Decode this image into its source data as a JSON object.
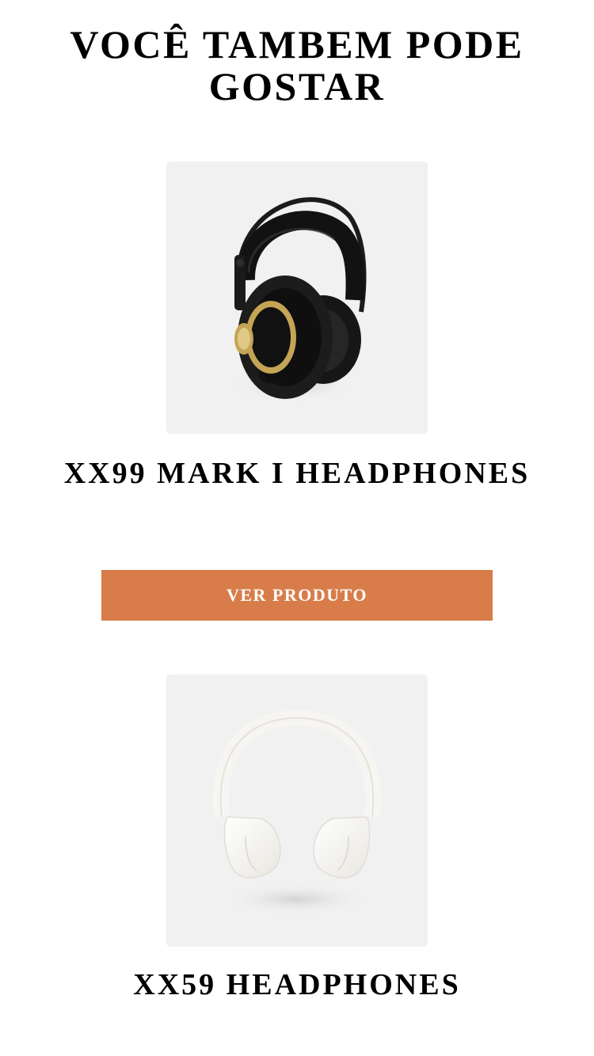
{
  "section": {
    "title": "VOCÊ TAMBEM PODE GOSTAR"
  },
  "products": [
    {
      "name": "XX99 MARK I HEADPHONES",
      "button_label": "VER PRODUTO",
      "image_icon": "black-headphones-icon"
    },
    {
      "name": "XX59 HEADPHONES",
      "image_icon": "white-headphones-icon"
    }
  ],
  "colors": {
    "accent": "#d87d4a",
    "image_background": "#f1f1f1",
    "text": "#000000",
    "button_text": "#ffffff"
  }
}
